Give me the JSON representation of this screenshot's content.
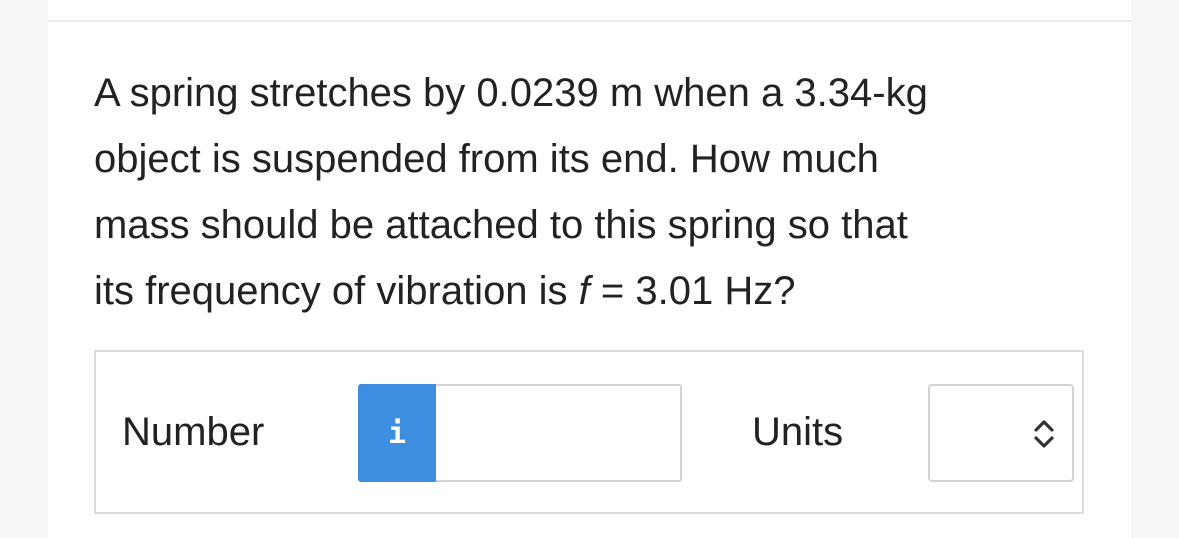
{
  "question": {
    "line1": "A spring stretches by 0.0239 m when a 3.34-kg",
    "line2": "object is suspended from its end. How much",
    "line3": "mass should be attached to this spring so that",
    "line4_pre": "its frequency of vibration is ",
    "line4_var": "f",
    "line4_post": " = 3.01 Hz?"
  },
  "answer": {
    "number_label": "Number",
    "info_button_label": "i",
    "number_value": "",
    "number_placeholder": "",
    "units_label": "Units",
    "units_selected": ""
  },
  "colors": {
    "info_button": "#3d8ee0",
    "border": "#dcdcdc",
    "text": "#222222"
  },
  "icons": {
    "info": "info-icon",
    "units_dropdown": "chevron-up-down-icon"
  }
}
